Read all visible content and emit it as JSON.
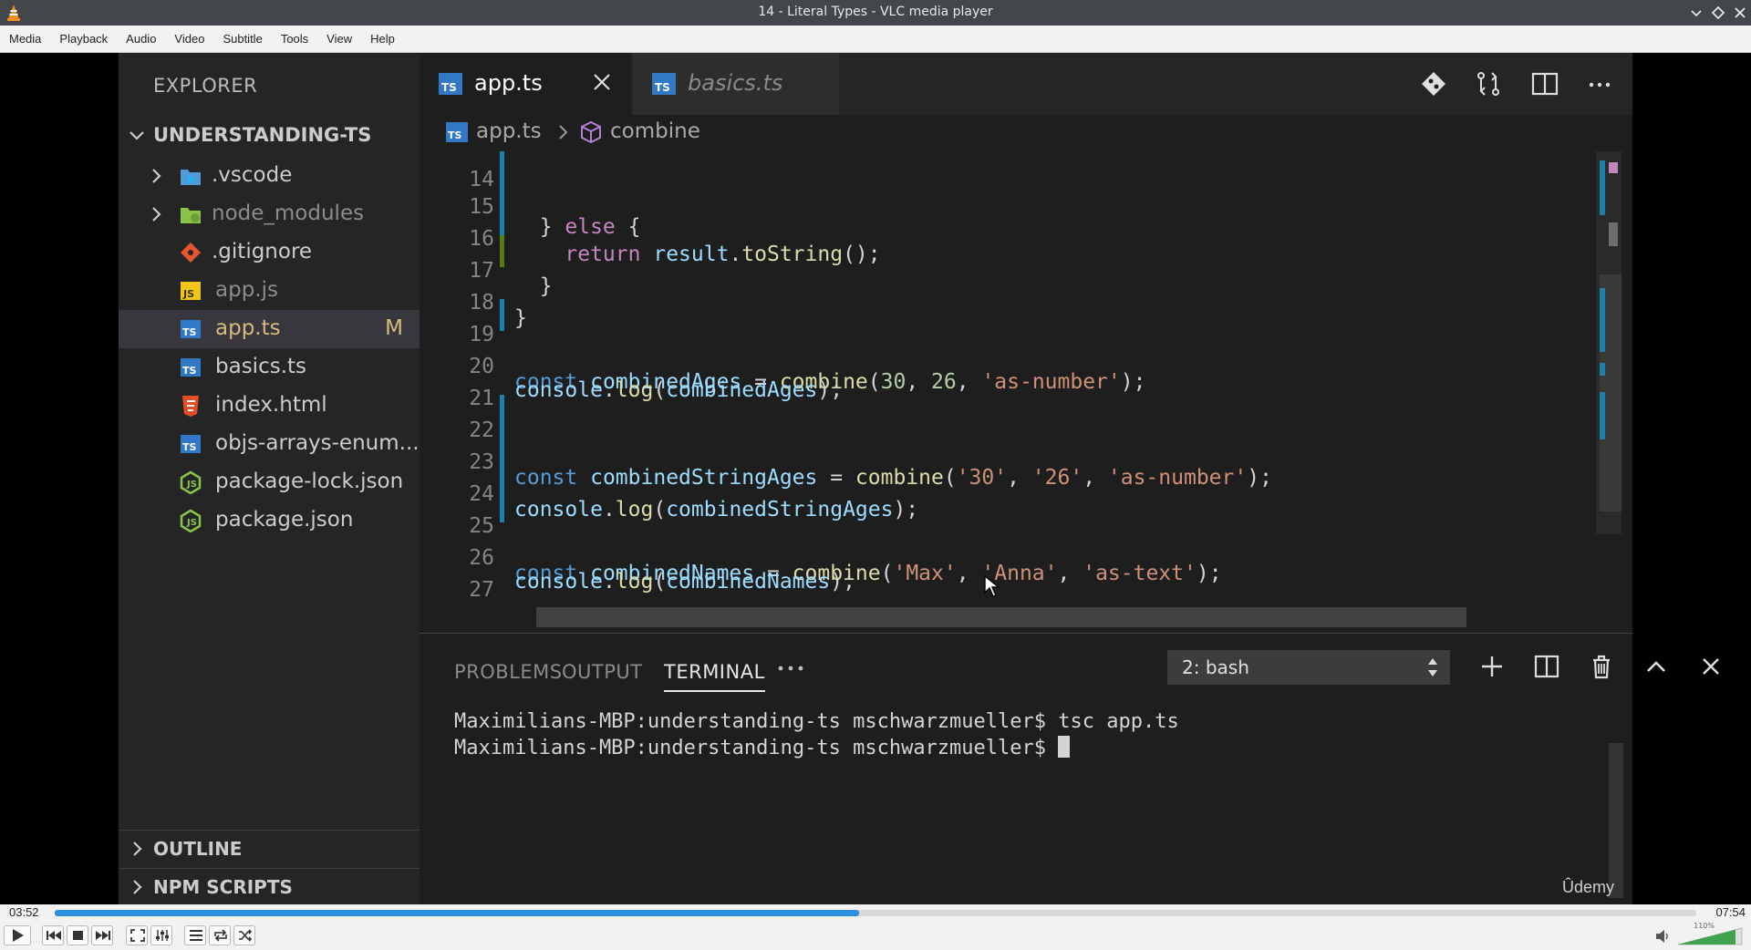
{
  "window": {
    "title": "14 - Literal Types - VLC media player"
  },
  "menubar": {
    "items": [
      "Media",
      "Playback",
      "Audio",
      "Video",
      "Subtitle",
      "Tools",
      "View",
      "Help"
    ]
  },
  "vscode": {
    "sidebar": {
      "title": "EXPLORER",
      "project": "UNDERSTANDING-TS",
      "files": [
        {
          "name": ".vscode",
          "type": "folder",
          "icon": "vscode-folder-icon"
        },
        {
          "name": "node_modules",
          "type": "folder",
          "icon": "node-folder-icon"
        },
        {
          "name": ".gitignore",
          "type": "file",
          "icon": "git-icon"
        },
        {
          "name": "app.js",
          "type": "file",
          "icon": "js-icon"
        },
        {
          "name": "app.ts",
          "type": "file",
          "icon": "ts-icon",
          "badge": "M",
          "selected": true
        },
        {
          "name": "basics.ts",
          "type": "file",
          "icon": "ts-icon"
        },
        {
          "name": "index.html",
          "type": "file",
          "icon": "html-icon"
        },
        {
          "name": "objs-arrays-enum...",
          "type": "file",
          "icon": "ts-icon"
        },
        {
          "name": "package-lock.json",
          "type": "file",
          "icon": "node-icon"
        },
        {
          "name": "package.json",
          "type": "file",
          "icon": "node-icon"
        }
      ],
      "outline": "OUTLINE",
      "npm_scripts": "NPM SCRIPTS"
    },
    "tabs": [
      {
        "label": "app.ts",
        "active": true
      },
      {
        "label": "basics.ts",
        "active": false
      }
    ],
    "breadcrumb": {
      "file": "app.ts",
      "symbol": "combine"
    },
    "editor": {
      "lines": [
        {
          "n": "14",
          "text": "  } else {"
        },
        {
          "n": "15",
          "text": "    return result.toString();"
        },
        {
          "n": "16",
          "text": "  }"
        },
        {
          "n": "17",
          "text": "}"
        },
        {
          "n": "18",
          "text": ""
        },
        {
          "n": "19",
          "text": "const combinedAges = combine(30, 26, 'as-number');"
        },
        {
          "n": "20",
          "text": "console.log(combinedAges);"
        },
        {
          "n": "21",
          "text": ""
        },
        {
          "n": "22",
          "text": "const combinedStringAges = combine('30', '26', 'as-number');"
        },
        {
          "n": "23",
          "text": "console.log(combinedStringAges);"
        },
        {
          "n": "24",
          "text": ""
        },
        {
          "n": "25",
          "text": "const combinedNames = combine('Max', 'Anna', 'as-text');"
        },
        {
          "n": "26",
          "text": "console.log(combinedNames);"
        },
        {
          "n": "27",
          "text": ""
        }
      ]
    },
    "panel": {
      "tabs": [
        "PROBLEMS",
        "OUTPUT",
        "TERMINAL"
      ],
      "active_tab": "TERMINAL",
      "terminal_select": "2: bash",
      "terminal_lines": [
        "Maximilians-MBP:understanding-ts mschwarzmueller$ tsc app.ts",
        "Maximilians-MBP:understanding-ts mschwarzmueller$ "
      ]
    },
    "watermark": "Ûdemy"
  },
  "player": {
    "elapsed": "03:52",
    "total": "07:54",
    "progress_fraction": 0.49,
    "volume_label": "110%",
    "volume_fraction": 0.9
  },
  "colors": {
    "accent": "#2f8fe0",
    "ts_blue": "#3178c6",
    "modified": "#d7ba7d"
  }
}
